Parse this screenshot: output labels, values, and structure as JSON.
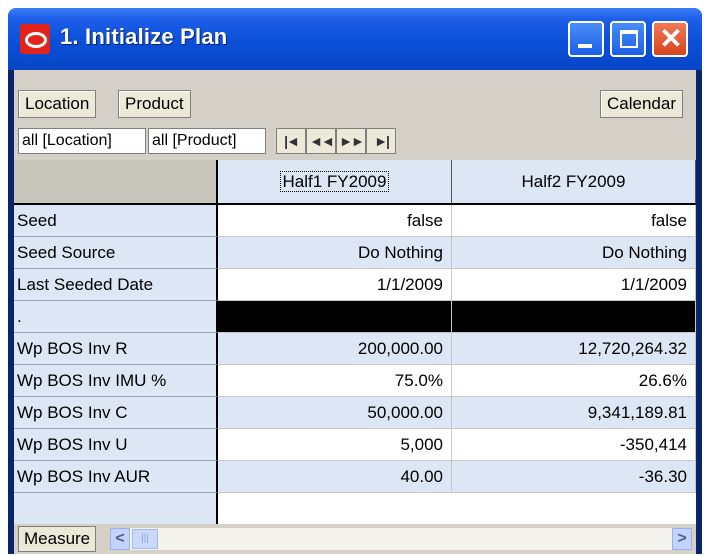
{
  "window": {
    "title": "1. Initialize Plan",
    "close_glyph": "✕"
  },
  "toolbar": {
    "location_label": "Location",
    "product_label": "Product",
    "calendar_label": "Calendar"
  },
  "dims": {
    "location_value": "all [Location]",
    "product_value": "all [Product]",
    "nav": [
      "|◄",
      "◄◄",
      "►►",
      "►|"
    ]
  },
  "grid": {
    "columns": [
      "Half1 FY2009",
      "Half2 FY2009"
    ],
    "rows": [
      {
        "label": "Seed",
        "values": [
          "false",
          "false"
        ]
      },
      {
        "label": "Seed Source",
        "values": [
          "Do Nothing",
          "Do Nothing"
        ]
      },
      {
        "label": "Last Seeded Date",
        "values": [
          "1/1/2009",
          "1/1/2009"
        ]
      },
      {
        "label": ".",
        "values": [
          "",
          ""
        ]
      },
      {
        "label": "Wp BOS Inv R",
        "values": [
          "200,000.00",
          "12,720,264.32"
        ]
      },
      {
        "label": "Wp BOS Inv IMU %",
        "values": [
          "75.0%",
          "26.6%"
        ]
      },
      {
        "label": "Wp BOS Inv C",
        "values": [
          "50,000.00",
          "9,341,189.81"
        ]
      },
      {
        "label": "Wp BOS Inv U",
        "values": [
          "5,000",
          "-350,414"
        ]
      },
      {
        "label": "Wp BOS Inv AUR",
        "values": [
          "40.00",
          "-36.30"
        ]
      }
    ]
  },
  "bottom": {
    "measure_label": "Measure",
    "scroll_left": "<",
    "scroll_right": ">",
    "thumb_grip": "|||"
  },
  "colors": {
    "title_bar": "#0a4fd9",
    "header_blue": "#dde6f4",
    "oracle_red": "#e2231a"
  },
  "icons": [
    "oracle-logo-icon",
    "minimize-icon",
    "maximize-icon",
    "close-icon",
    "first-icon",
    "previous-icon",
    "next-icon",
    "last-icon",
    "scroll-left-icon",
    "scroll-right-icon"
  ]
}
